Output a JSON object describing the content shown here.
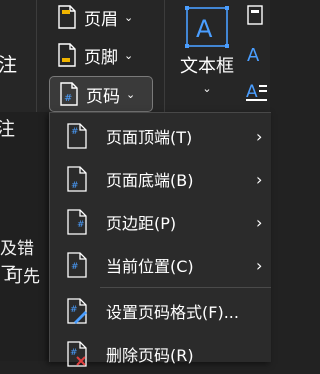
{
  "ribbon": {
    "header": {
      "label": "页眉",
      "caret": "⌄"
    },
    "footer": {
      "label": "页脚",
      "caret": "⌄"
    },
    "page_number": {
      "label": "页码",
      "caret": "⌄"
    },
    "textbox": {
      "glyph": "A",
      "label": "文本框",
      "caret": "⌄"
    },
    "left_fragments": [
      "注",
      "注"
    ],
    "accent_color": "#4a9eff"
  },
  "document": {
    "line1": "及错了",
    "line2": "可先"
  },
  "menu": {
    "items": [
      {
        "label": "页面顶端(T)",
        "has_submenu": true,
        "arrow": "›"
      },
      {
        "label": "页面底端(B)",
        "has_submenu": true,
        "arrow": "›"
      },
      {
        "label": "页边距(P)",
        "has_submenu": true,
        "arrow": "›"
      },
      {
        "label": "当前位置(C)",
        "has_submenu": true,
        "arrow": "›"
      },
      {
        "label": "设置页码格式(F)...",
        "has_submenu": false
      },
      {
        "label": "删除页码(R)",
        "has_submenu": false
      }
    ]
  }
}
